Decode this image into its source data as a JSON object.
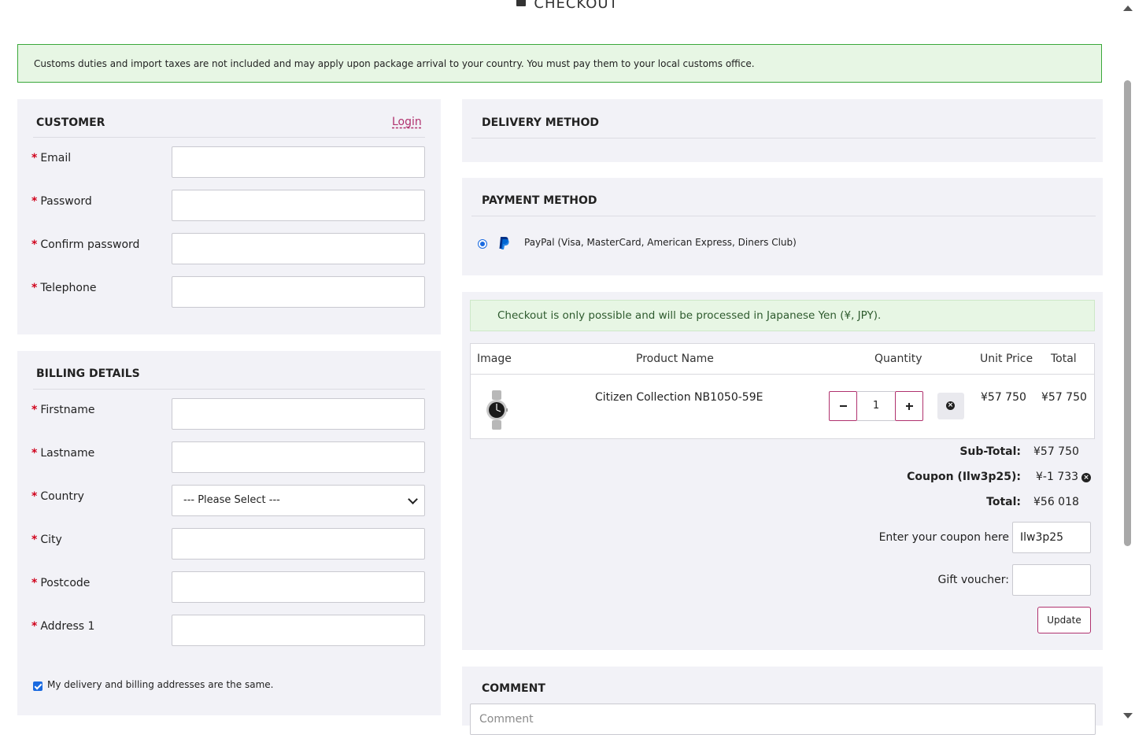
{
  "page": {
    "title": "CHECKOUT"
  },
  "notice": {
    "customs": "Customs duties and import taxes are not included and may apply upon package arrival to your country. You must pay them to your local customs office."
  },
  "customer": {
    "title": "CUSTOMER",
    "login_link": "Login",
    "fields": {
      "email": {
        "label": "Email",
        "value": ""
      },
      "password": {
        "label": "Password",
        "value": ""
      },
      "confirm_password": {
        "label": "Confirm password",
        "value": ""
      },
      "telephone": {
        "label": "Telephone",
        "value": ""
      }
    }
  },
  "billing": {
    "title": "BILLING DETAILS",
    "fields": {
      "firstname": {
        "label": "Firstname",
        "value": ""
      },
      "lastname": {
        "label": "Lastname",
        "value": ""
      },
      "country": {
        "label": "Country",
        "selected": "--- Please Select ---"
      },
      "city": {
        "label": "City",
        "value": ""
      },
      "postcode": {
        "label": "Postcode",
        "value": ""
      },
      "address1": {
        "label": "Address 1",
        "value": ""
      }
    },
    "same_address": {
      "label": "My delivery and billing addresses are the same.",
      "checked": true
    }
  },
  "required_mark": "*",
  "delivery": {
    "title": "DELIVERY METHOD"
  },
  "payment": {
    "title": "PAYMENT METHOD",
    "options": [
      {
        "label": "PayPal (Visa, MasterCard, American Express, Diners Club)",
        "selected": true,
        "icon": "paypal-icon"
      }
    ]
  },
  "cart": {
    "currency_notice": "Checkout is only possible and will be processed in Japanese Yen (¥, JPY).",
    "columns": {
      "image": "Image",
      "product_name": "Product Name",
      "quantity": "Quantity",
      "unit_price": "Unit Price",
      "total": "Total"
    },
    "items": [
      {
        "name": "Citizen Collection NB1050-59E",
        "quantity": "1",
        "unit_price": "¥57 750",
        "total": "¥57 750",
        "image_icon": "watch-image"
      }
    ],
    "totals": {
      "subtotal_label": "Sub-Total:",
      "subtotal_value": "¥57 750",
      "coupon_label": "Coupon (Ilw3p25):",
      "coupon_value": "¥-1 733",
      "total_label": "Total:",
      "total_value": "¥56 018"
    },
    "coupon": {
      "label": "Enter your coupon here",
      "value": "Ilw3p25"
    },
    "voucher": {
      "label": "Gift voucher:",
      "value": ""
    },
    "update_button": "Update"
  },
  "comment": {
    "title": "COMMENT",
    "placeholder": "Comment"
  },
  "colors": {
    "accent": "#b0326e",
    "success_bg": "#e7f6e4",
    "success_border": "#3aa83a",
    "panel_bg": "#f2f2f7",
    "required": "#d0021b"
  }
}
